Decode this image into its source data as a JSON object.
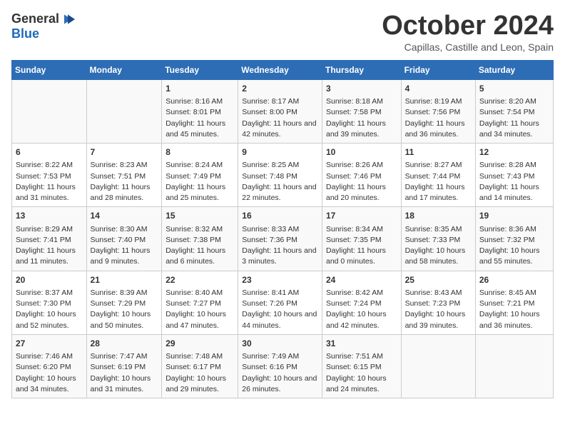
{
  "header": {
    "logo_general": "General",
    "logo_blue": "Blue",
    "month": "October 2024",
    "location": "Capillas, Castille and Leon, Spain"
  },
  "days_of_week": [
    "Sunday",
    "Monday",
    "Tuesday",
    "Wednesday",
    "Thursday",
    "Friday",
    "Saturday"
  ],
  "weeks": [
    [
      {
        "day": "",
        "info": ""
      },
      {
        "day": "",
        "info": ""
      },
      {
        "day": "1",
        "info": "Sunrise: 8:16 AM\nSunset: 8:01 PM\nDaylight: 11 hours and 45 minutes."
      },
      {
        "day": "2",
        "info": "Sunrise: 8:17 AM\nSunset: 8:00 PM\nDaylight: 11 hours and 42 minutes."
      },
      {
        "day": "3",
        "info": "Sunrise: 8:18 AM\nSunset: 7:58 PM\nDaylight: 11 hours and 39 minutes."
      },
      {
        "day": "4",
        "info": "Sunrise: 8:19 AM\nSunset: 7:56 PM\nDaylight: 11 hours and 36 minutes."
      },
      {
        "day": "5",
        "info": "Sunrise: 8:20 AM\nSunset: 7:54 PM\nDaylight: 11 hours and 34 minutes."
      }
    ],
    [
      {
        "day": "6",
        "info": "Sunrise: 8:22 AM\nSunset: 7:53 PM\nDaylight: 11 hours and 31 minutes."
      },
      {
        "day": "7",
        "info": "Sunrise: 8:23 AM\nSunset: 7:51 PM\nDaylight: 11 hours and 28 minutes."
      },
      {
        "day": "8",
        "info": "Sunrise: 8:24 AM\nSunset: 7:49 PM\nDaylight: 11 hours and 25 minutes."
      },
      {
        "day": "9",
        "info": "Sunrise: 8:25 AM\nSunset: 7:48 PM\nDaylight: 11 hours and 22 minutes."
      },
      {
        "day": "10",
        "info": "Sunrise: 8:26 AM\nSunset: 7:46 PM\nDaylight: 11 hours and 20 minutes."
      },
      {
        "day": "11",
        "info": "Sunrise: 8:27 AM\nSunset: 7:44 PM\nDaylight: 11 hours and 17 minutes."
      },
      {
        "day": "12",
        "info": "Sunrise: 8:28 AM\nSunset: 7:43 PM\nDaylight: 11 hours and 14 minutes."
      }
    ],
    [
      {
        "day": "13",
        "info": "Sunrise: 8:29 AM\nSunset: 7:41 PM\nDaylight: 11 hours and 11 minutes."
      },
      {
        "day": "14",
        "info": "Sunrise: 8:30 AM\nSunset: 7:40 PM\nDaylight: 11 hours and 9 minutes."
      },
      {
        "day": "15",
        "info": "Sunrise: 8:32 AM\nSunset: 7:38 PM\nDaylight: 11 hours and 6 minutes."
      },
      {
        "day": "16",
        "info": "Sunrise: 8:33 AM\nSunset: 7:36 PM\nDaylight: 11 hours and 3 minutes."
      },
      {
        "day": "17",
        "info": "Sunrise: 8:34 AM\nSunset: 7:35 PM\nDaylight: 11 hours and 0 minutes."
      },
      {
        "day": "18",
        "info": "Sunrise: 8:35 AM\nSunset: 7:33 PM\nDaylight: 10 hours and 58 minutes."
      },
      {
        "day": "19",
        "info": "Sunrise: 8:36 AM\nSunset: 7:32 PM\nDaylight: 10 hours and 55 minutes."
      }
    ],
    [
      {
        "day": "20",
        "info": "Sunrise: 8:37 AM\nSunset: 7:30 PM\nDaylight: 10 hours and 52 minutes."
      },
      {
        "day": "21",
        "info": "Sunrise: 8:39 AM\nSunset: 7:29 PM\nDaylight: 10 hours and 50 minutes."
      },
      {
        "day": "22",
        "info": "Sunrise: 8:40 AM\nSunset: 7:27 PM\nDaylight: 10 hours and 47 minutes."
      },
      {
        "day": "23",
        "info": "Sunrise: 8:41 AM\nSunset: 7:26 PM\nDaylight: 10 hours and 44 minutes."
      },
      {
        "day": "24",
        "info": "Sunrise: 8:42 AM\nSunset: 7:24 PM\nDaylight: 10 hours and 42 minutes."
      },
      {
        "day": "25",
        "info": "Sunrise: 8:43 AM\nSunset: 7:23 PM\nDaylight: 10 hours and 39 minutes."
      },
      {
        "day": "26",
        "info": "Sunrise: 8:45 AM\nSunset: 7:21 PM\nDaylight: 10 hours and 36 minutes."
      }
    ],
    [
      {
        "day": "27",
        "info": "Sunrise: 7:46 AM\nSunset: 6:20 PM\nDaylight: 10 hours and 34 minutes."
      },
      {
        "day": "28",
        "info": "Sunrise: 7:47 AM\nSunset: 6:19 PM\nDaylight: 10 hours and 31 minutes."
      },
      {
        "day": "29",
        "info": "Sunrise: 7:48 AM\nSunset: 6:17 PM\nDaylight: 10 hours and 29 minutes."
      },
      {
        "day": "30",
        "info": "Sunrise: 7:49 AM\nSunset: 6:16 PM\nDaylight: 10 hours and 26 minutes."
      },
      {
        "day": "31",
        "info": "Sunrise: 7:51 AM\nSunset: 6:15 PM\nDaylight: 10 hours and 24 minutes."
      },
      {
        "day": "",
        "info": ""
      },
      {
        "day": "",
        "info": ""
      }
    ]
  ]
}
